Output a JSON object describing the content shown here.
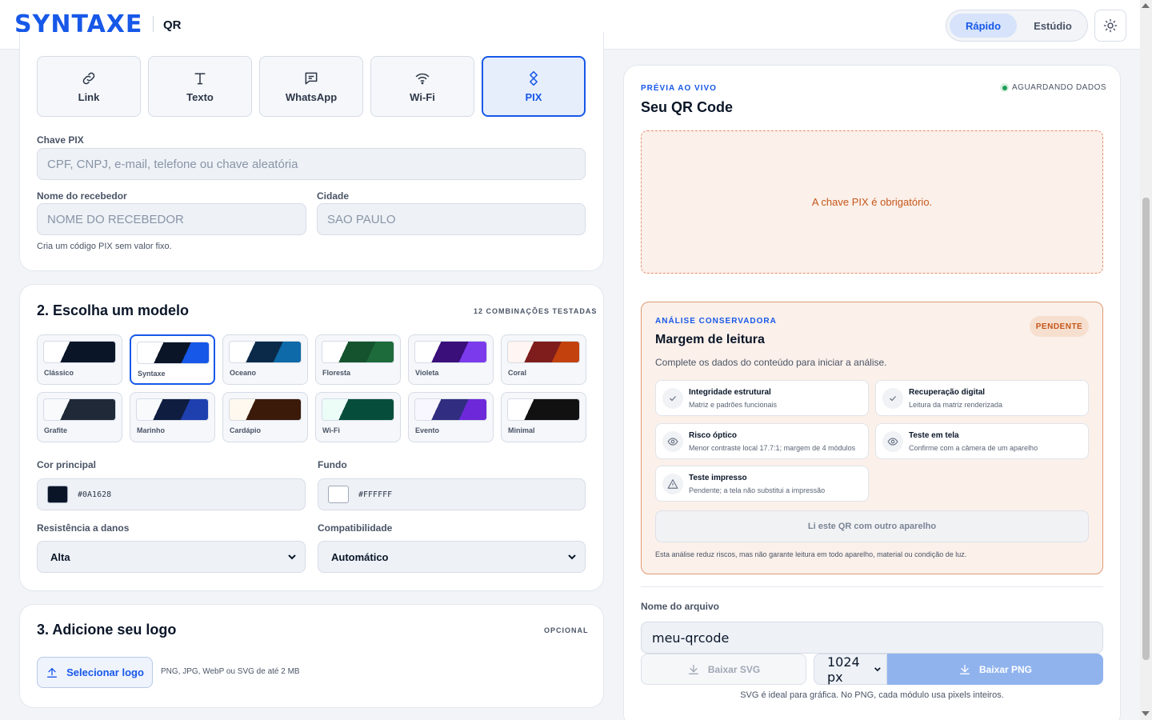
{
  "header": {
    "brand": "SYNTAXE",
    "product": "QR",
    "modes": [
      "Rápido",
      "Estúdio"
    ],
    "active_mode": "Rápido",
    "theme_icon": "sun-icon"
  },
  "content_types": [
    {
      "label": "Link",
      "icon": "link-icon",
      "active": false
    },
    {
      "label": "Texto",
      "icon": "text-icon",
      "active": false
    },
    {
      "label": "WhatsApp",
      "icon": "chat-icon",
      "active": false
    },
    {
      "label": "Wi-Fi",
      "icon": "wifi-icon",
      "active": false
    },
    {
      "label": "PIX",
      "icon": "pix-icon",
      "active": true
    }
  ],
  "pix_form": {
    "key_label": "Chave PIX",
    "key_placeholder": "CPF, CNPJ, e-mail, telefone ou chave aleatória",
    "name_label": "Nome do recebedor",
    "name_placeholder": "NOME DO RECEBEDOR",
    "city_label": "Cidade",
    "city_placeholder": "SAO PAULO",
    "hint": "Cria um código PIX sem valor fixo."
  },
  "model_section": {
    "title": "2. Escolha um modelo",
    "caption": "12 COMBINAÇÕES TESTADAS",
    "templates": [
      {
        "name": "Clássico",
        "light": "#ffffff",
        "dark": "#0a1628",
        "accent": "#0a1628",
        "active": false
      },
      {
        "name": "Syntaxe",
        "light": "#ffffff",
        "dark": "#0a1628",
        "accent": "#1758e8",
        "active": true
      },
      {
        "name": "Oceano",
        "light": "#ffffff",
        "dark": "#0b2a4a",
        "accent": "#0e6aa8",
        "active": false
      },
      {
        "name": "Floresta",
        "light": "#ffffff",
        "dark": "#14532d",
        "accent": "#1d6b3a",
        "active": false
      },
      {
        "name": "Violeta",
        "light": "#ffffff",
        "dark": "#3b0f7a",
        "accent": "#7c3aed",
        "active": false
      },
      {
        "name": "Coral",
        "light": "#fff5f2",
        "dark": "#7f1d1d",
        "accent": "#c2410c",
        "active": false
      },
      {
        "name": "Grafite",
        "light": "#f8fafc",
        "dark": "#1f2937",
        "accent": "#1f2937",
        "active": false
      },
      {
        "name": "Marinho",
        "light": "#f8fafc",
        "dark": "#0f1d40",
        "accent": "#1e40af",
        "active": false
      },
      {
        "name": "Cardápio",
        "light": "#fff8ee",
        "dark": "#3b1a0a",
        "accent": "#3b1a0a",
        "active": false
      },
      {
        "name": "Wi-Fi",
        "light": "#ecfdf8",
        "dark": "#064e3b",
        "accent": "#064e3b",
        "active": false
      },
      {
        "name": "Evento",
        "light": "#f8f7ff",
        "dark": "#312e81",
        "accent": "#6d28d9",
        "active": false
      },
      {
        "name": "Minimal",
        "light": "#ffffff",
        "dark": "#111111",
        "accent": "#111111",
        "active": false
      }
    ],
    "main_color_label": "Cor principal",
    "main_color": "#0A1628",
    "background_label": "Fundo",
    "background_color": "#FFFFFF",
    "resistance_label": "Resistência a danos",
    "resistance_value": "Alta",
    "compat_label": "Compatibilidade",
    "compat_value": "Automático"
  },
  "logo_section": {
    "title": "3. Adicione seu logo",
    "caption": "OPCIONAL",
    "button": "Selecionar logo",
    "hint": "PNG, JPG, WebP ou SVG de até 2 MB"
  },
  "preview": {
    "eyebrow": "PRÉVIA AO VIVO",
    "title": "Seu QR Code",
    "status": "AGUARDANDO DADOS",
    "status_color": "#1f9d55",
    "message": "A chave PIX é obrigatório."
  },
  "analysis": {
    "eyebrow": "ANÁLISE CONSERVADORA",
    "title": "Margem de leitura",
    "badge": "PENDENTE",
    "intro": "Complete os dados do conteúdo para iniciar a análise.",
    "checks": [
      {
        "title": "Integridade estrutural",
        "sub": "Matriz e padrões funcionais",
        "icon": "check-icon"
      },
      {
        "title": "Recuperação digital",
        "sub": "Leitura da matriz renderizada",
        "icon": "check-icon"
      },
      {
        "title": "Risco óptico",
        "sub": "Menor contraste local 17.7:1; margem de 4 módulos",
        "icon": "eye-icon"
      },
      {
        "title": "Teste em tela",
        "sub": "Confirme com a câmera de um aparelho",
        "icon": "eye-icon"
      },
      {
        "title": "Teste impresso",
        "sub": "Pendente; a tela não substitui a impressão",
        "icon": "warning-icon"
      }
    ],
    "read_button": "Li este QR com outro aparelho",
    "disclaimer": "Esta análise reduz riscos, mas não garante leitura em todo aparelho, material ou condição de luz."
  },
  "export": {
    "filename_label": "Nome do arquivo",
    "filename": "meu-qrcode",
    "svg_button": "Baixar SVG",
    "size": "1024 px",
    "png_button": "Baixar PNG",
    "note": "SVG é ideal para gráfica. No PNG, cada módulo usa pixels inteiros."
  }
}
